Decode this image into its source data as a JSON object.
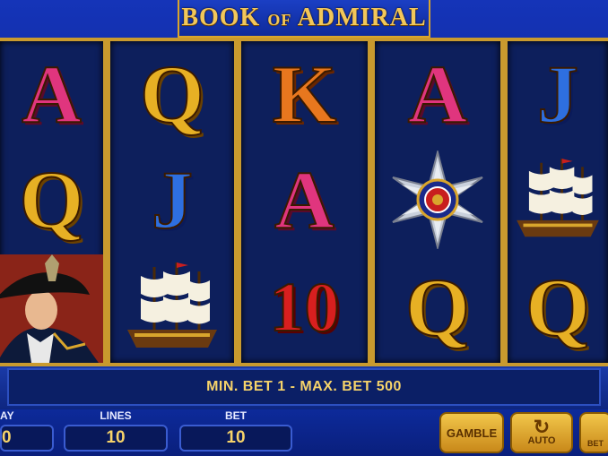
{
  "game": {
    "title_main_1": "BOOK",
    "title_small": "OF",
    "title_main_2": "ADMIRAL"
  },
  "reels": [
    [
      "A",
      "Q",
      "admiral"
    ],
    [
      "Q",
      "J",
      "ship"
    ],
    [
      "K",
      "A",
      "10"
    ],
    [
      "A",
      "star-medal",
      "Q"
    ],
    [
      "J",
      "ship",
      "Q"
    ]
  ],
  "info_message": "MIN. BET 1 - MAX. BET 500",
  "controls": {
    "play_label": "AY",
    "play_value": "0",
    "lines_label": "LINES",
    "lines_value": "10",
    "bet_label": "BET",
    "bet_value": "10",
    "gamble_label": "GAMBLE",
    "auto_label": "AUTO",
    "bet_button_label": "BET"
  },
  "colors": {
    "gold": "#e7b024",
    "pink": "#e0357e",
    "blue": "#2e6fe0",
    "orange": "#e8771e",
    "red": "#d81f1f"
  }
}
